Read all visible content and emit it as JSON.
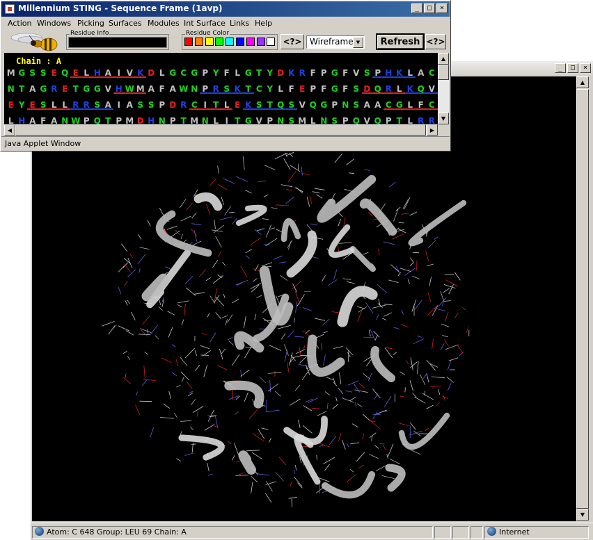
{
  "sequence_window": {
    "title": "Millennium STING - Sequence Frame (1avp)",
    "menu": [
      "Action",
      "Windows",
      "Picking",
      "Surfaces",
      "Modules",
      "Int Surface",
      "Links",
      "Help"
    ],
    "residue_info_label": "Residue Info",
    "residue_info_value": "",
    "residue_color_label": "Residue Color",
    "residue_colors": [
      "#ff0000",
      "#ff8000",
      "#ffff00",
      "#00ff00",
      "#00ffff",
      "#0000ff",
      "#ff00ff",
      "#9933ff",
      "#ffffff"
    ],
    "nav_button": "<?>",
    "render_mode": "Wireframe",
    "refresh_button": "Refresh",
    "help_button": "<?>",
    "chain_label": "Chain : A",
    "status": "Java Applet Window",
    "rows": [
      "MGSSEQELHAIVKDLGCGPYFLGTYDKRFPGFVSPHKLACAIV",
      "NTAGRETGGVHWMAFAWNPRSKTCYLFEPFGFSDQRLKQVYQF",
      "EYESLLRRSAIASSPDRCITLEKSTQSVQGPNSAACGLFCCMF",
      "LHAFANWPQTPMDHNPTMNLITGVPNSMLNSPQVQPTLRRNQE"
    ]
  },
  "browser_window": {
    "status_text": "Atom: C  648  Group: LEU 69  Chain: A",
    "zone": "Internet"
  },
  "colors": {
    "residue_acidic": "#e02020",
    "residue_basic": "#2040e0",
    "residue_polar": "#20d020",
    "residue_hydrophobic": "#c0c0c0",
    "chain_label": "#ffff00"
  }
}
